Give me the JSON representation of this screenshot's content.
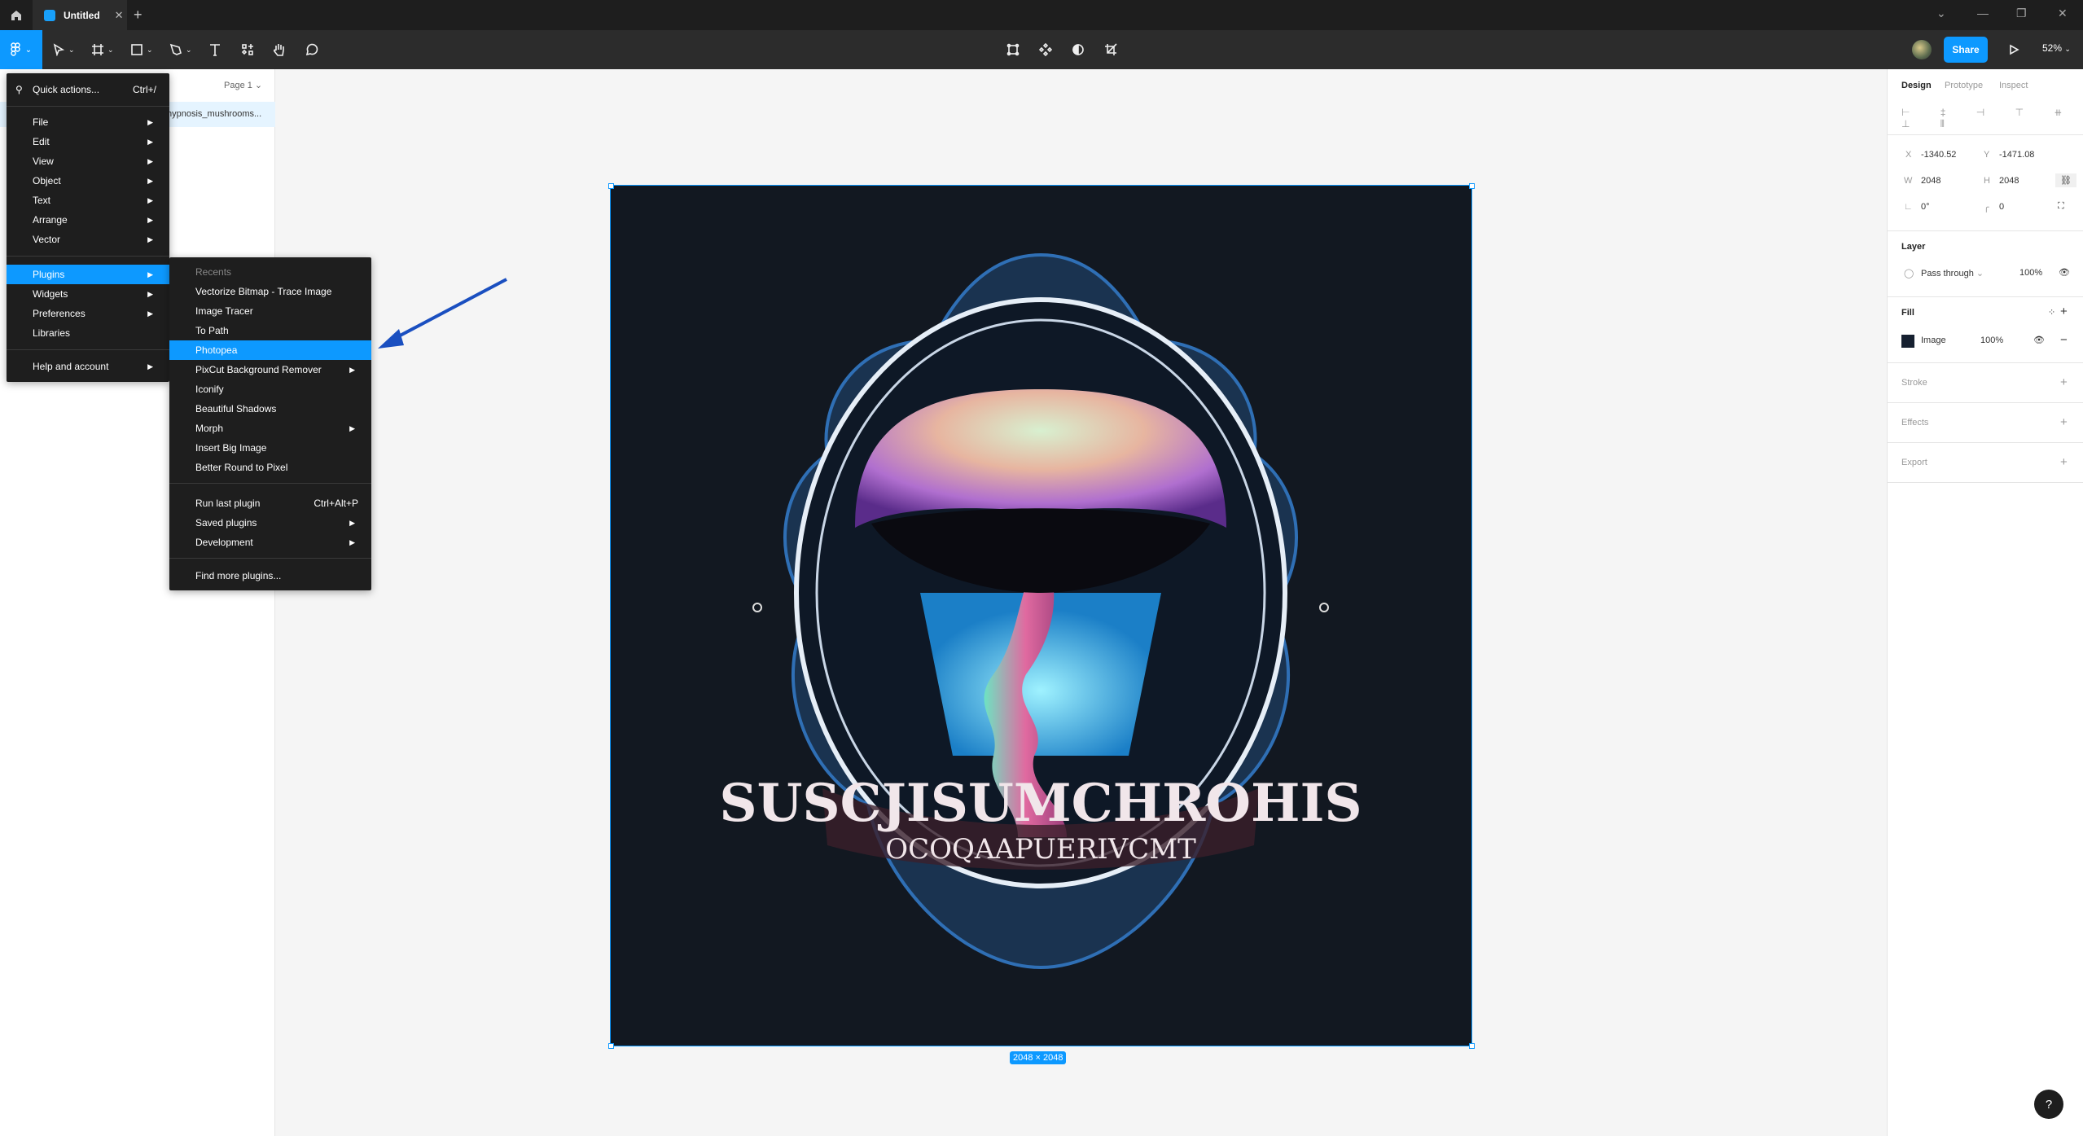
{
  "window": {
    "tab_title": "Untitled",
    "new_tab": "+"
  },
  "toolbar": {
    "share_label": "Share",
    "zoom": "52%"
  },
  "left_panel": {
    "page_selector": "Page 1",
    "layer_name": "hypnosis_mushrooms..."
  },
  "main_menu": {
    "quick_actions": {
      "label": "Quick actions...",
      "shortcut": "Ctrl+/"
    },
    "items": [
      {
        "label": "File",
        "submenu": true
      },
      {
        "label": "Edit",
        "submenu": true
      },
      {
        "label": "View",
        "submenu": true
      },
      {
        "label": "Object",
        "submenu": true
      },
      {
        "label": "Text",
        "submenu": true
      },
      {
        "label": "Arrange",
        "submenu": true
      },
      {
        "label": "Vector",
        "submenu": true
      },
      {
        "label": "Plugins",
        "submenu": true,
        "selected": true
      },
      {
        "label": "Widgets",
        "submenu": true
      },
      {
        "label": "Preferences",
        "submenu": true
      },
      {
        "label": "Libraries",
        "submenu": false
      },
      {
        "label": "Help and account",
        "submenu": true
      }
    ]
  },
  "plugins_menu": {
    "recents_header": "Recents",
    "recents": [
      {
        "label": "Vectorize Bitmap - Trace Image"
      },
      {
        "label": "Image Tracer"
      },
      {
        "label": "To Path"
      },
      {
        "label": "Photopea",
        "selected": true
      },
      {
        "label": "PixCut Background Remover",
        "submenu": true
      },
      {
        "label": "Iconify"
      },
      {
        "label": "Beautiful Shadows"
      },
      {
        "label": "Morph",
        "submenu": true
      },
      {
        "label": "Insert Big Image"
      },
      {
        "label": "Better Round to Pixel"
      }
    ],
    "run_last": {
      "label": "Run last plugin",
      "shortcut": "Ctrl+Alt+P"
    },
    "saved": {
      "label": "Saved plugins"
    },
    "development": {
      "label": "Development"
    },
    "find_more": {
      "label": "Find more plugins..."
    }
  },
  "canvas": {
    "dimensions": "2048 × 2048",
    "image_text_main": "SUSCJISUMCHROHIS",
    "image_text_sub": "OCOQAAPUERIVCMT"
  },
  "right_panel": {
    "tabs": [
      "Design",
      "Prototype",
      "Inspect"
    ],
    "x_label": "X",
    "x": "-1340.52",
    "y_label": "Y",
    "y": "-1471.08",
    "w_label": "W",
    "w": "2048",
    "h_label": "H",
    "h": "2048",
    "rotation": "0°",
    "radius": "0",
    "layer": {
      "title": "Layer",
      "blend": "Pass through",
      "opacity": "100%"
    },
    "fill": {
      "title": "Fill",
      "type": "Image",
      "opacity": "100%"
    },
    "stroke": "Stroke",
    "effects": "Effects",
    "export": "Export"
  },
  "colors": {
    "accent": "#0d99ff",
    "menu_bg": "#1e1e1e",
    "toolbar_bg": "#2c2c2c",
    "canvas_bg": "#f5f5f5"
  }
}
